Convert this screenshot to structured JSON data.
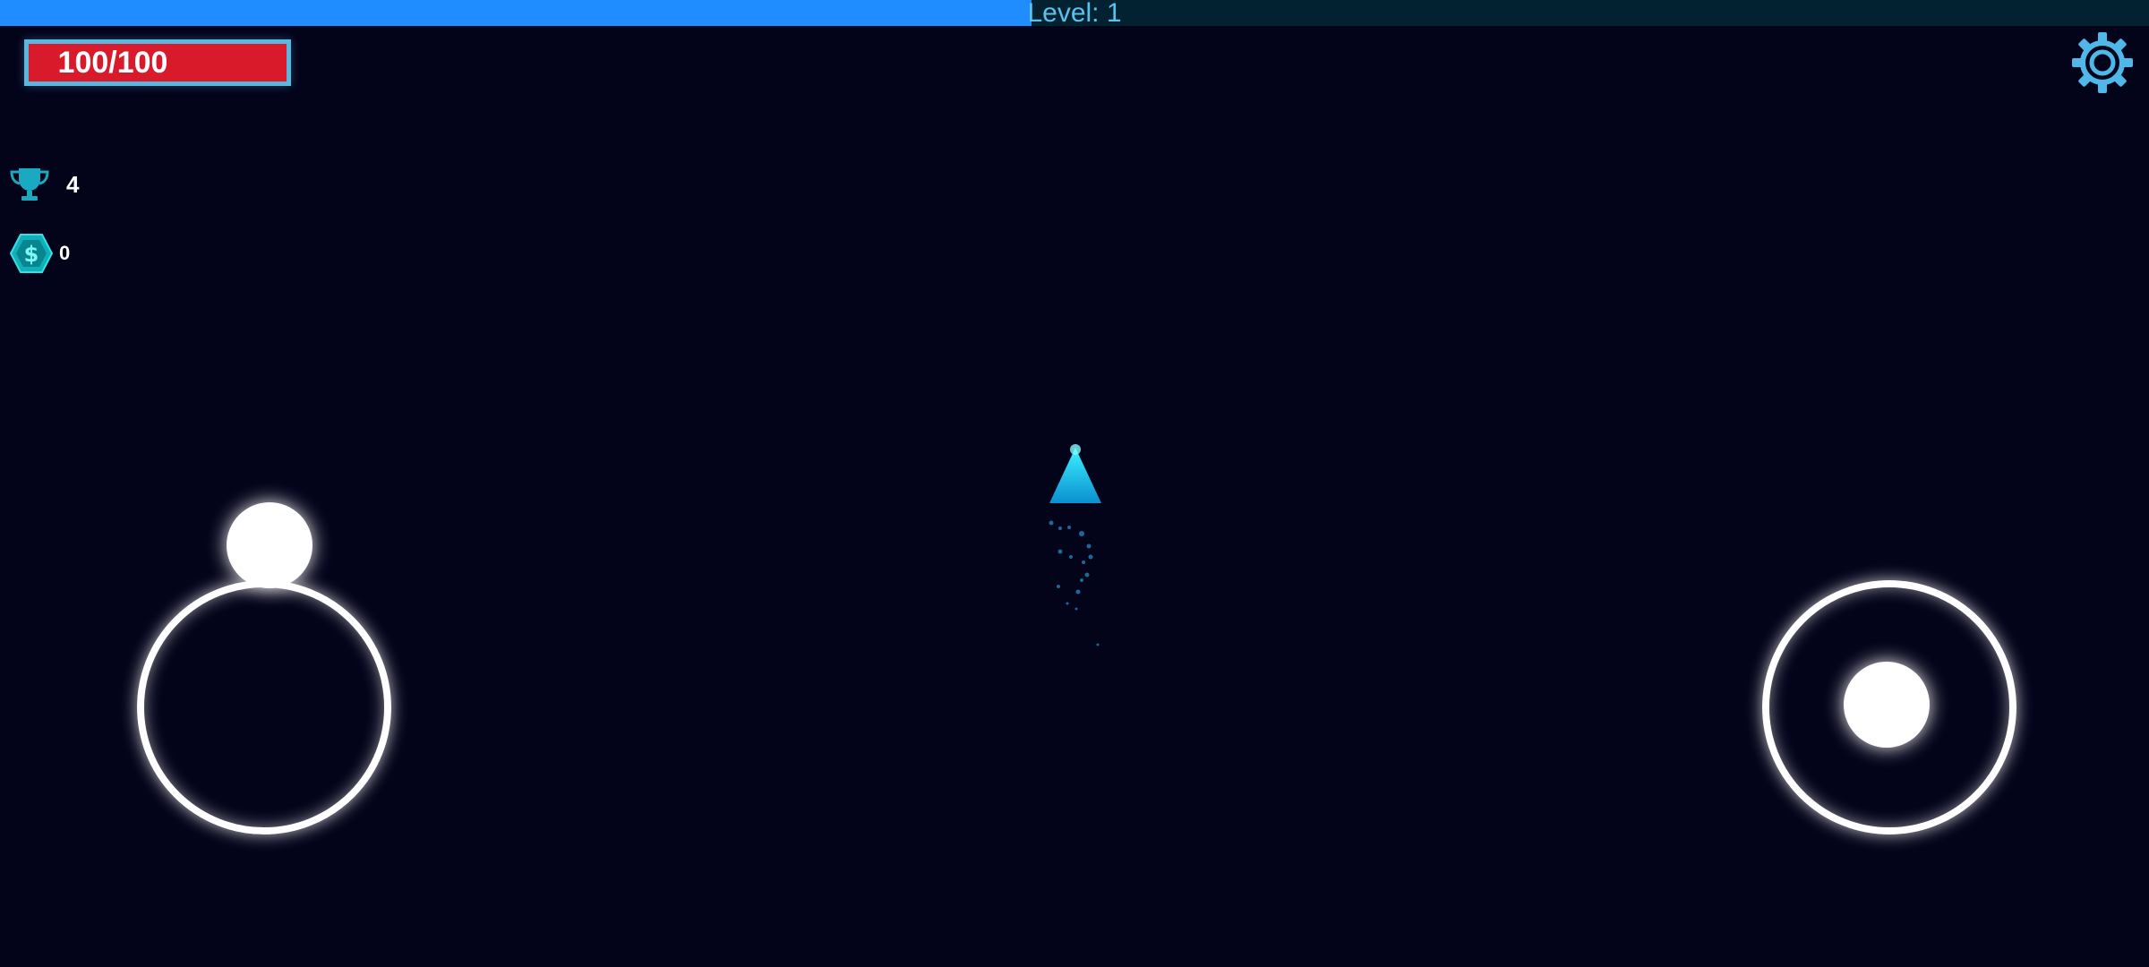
{
  "level": {
    "label": "Level: 1",
    "progress": 0.48
  },
  "health": {
    "text": "100/100",
    "current": 100,
    "max": 100
  },
  "stats": {
    "trophies": "4",
    "coins": "0"
  },
  "colors": {
    "background": "#03031a",
    "level_fill": "#1f8cff",
    "level_track": "#032231",
    "level_text": "#59c3ee",
    "health_fill": "#d81a2a",
    "health_border": "#5ab7df",
    "accent_cyan": "#19c7d6",
    "gear": "#4fb8e8"
  },
  "icons": {
    "settings": "gear-icon",
    "trophy": "trophy-icon",
    "coin": "dollar-hexagon-icon"
  }
}
